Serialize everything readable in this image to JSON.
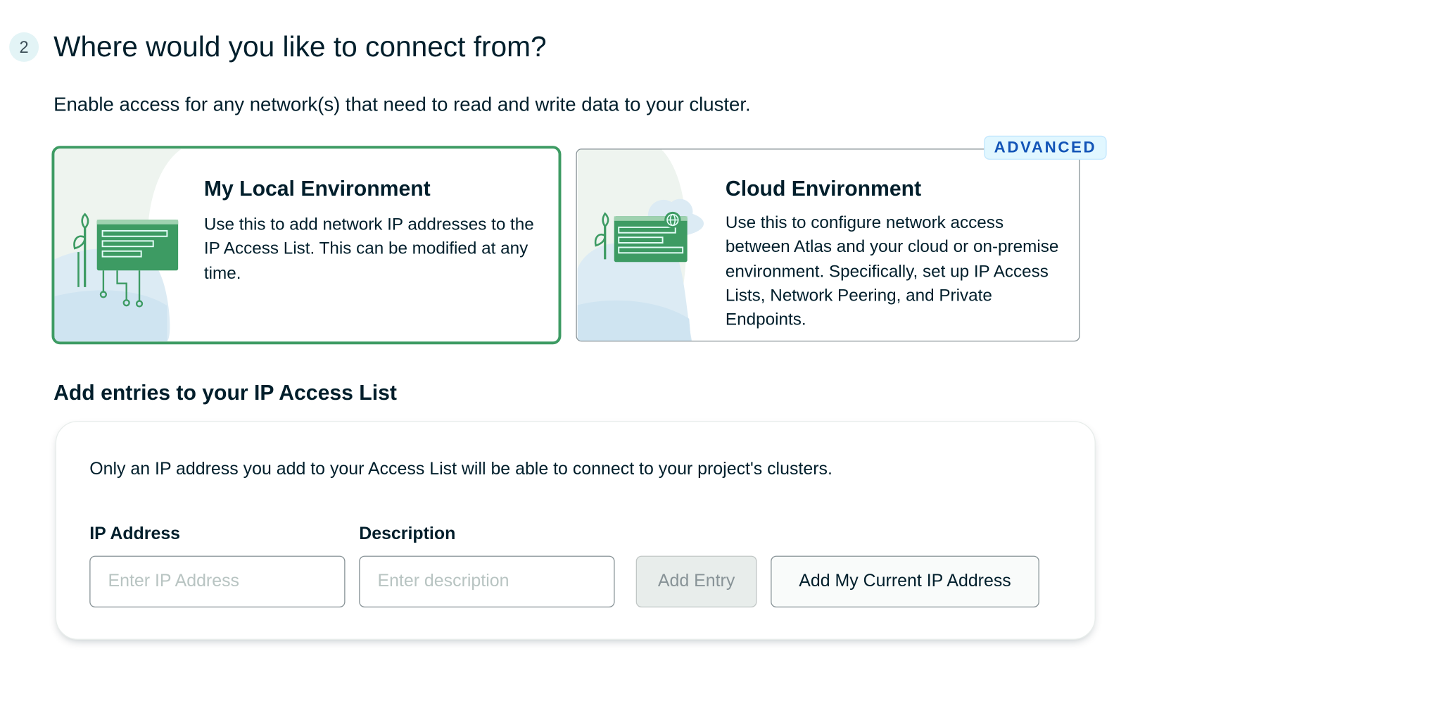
{
  "step": {
    "number": "2",
    "title": "Where would you like to connect from?",
    "description": "Enable access for any network(s) that need to read and write data to your cluster."
  },
  "environments": {
    "local": {
      "title": "My Local Environment",
      "description": "Use this to add network IP addresses to the IP Access List. This can be modified at any time.",
      "selected": true,
      "illustration_icon": "local-network-illustration-icon"
    },
    "cloud": {
      "title": "Cloud Environment",
      "description": "Use this to configure network access between Atlas and your cloud or on-premise environment. Specifically, set up IP Access Lists, Network Peering, and Private Endpoints.",
      "badge": "ADVANCED",
      "selected": false,
      "illustration_icon": "cloud-network-illustration-icon"
    }
  },
  "access_list": {
    "heading": "Add entries to your IP Access List",
    "note": "Only an IP address you add to your Access List will be able to connect to your project's clusters.",
    "ip_label": "IP Address",
    "ip_placeholder": "Enter IP Address",
    "ip_value": "",
    "description_label": "Description",
    "description_placeholder": "Enter description",
    "description_value": "",
    "add_entry_label": "Add Entry",
    "add_current_ip_label": "Add My Current IP Address"
  },
  "colors": {
    "selected_border": "#3d9b63",
    "illustration_green": "#3d9b63",
    "advanced_badge_text": "#1254b7",
    "advanced_badge_bg": "#e1f7ff"
  }
}
